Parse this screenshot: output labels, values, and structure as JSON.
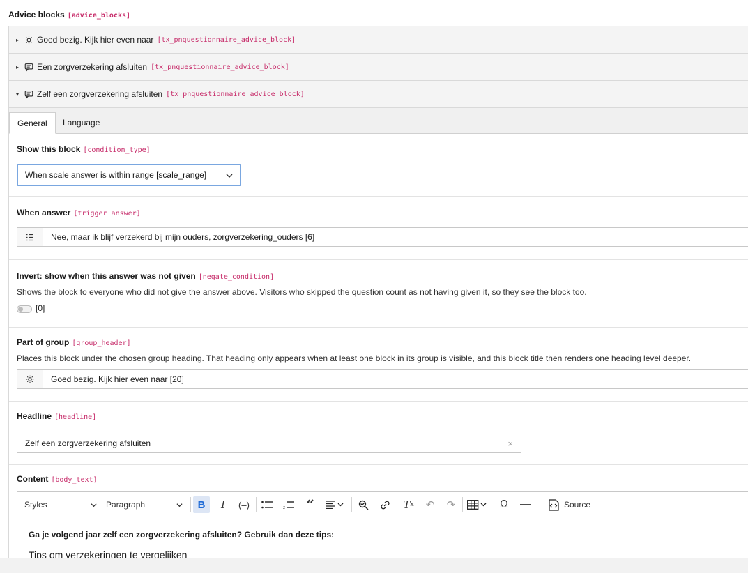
{
  "section": {
    "title": "Advice blocks",
    "key": "[advice_blocks]"
  },
  "panels": [
    {
      "title": "Goed bezig. Kijk hier even naar",
      "key": "[tx_pnquestionnaire_advice_block]",
      "icon": "lightbulb-icon",
      "expanded": false
    },
    {
      "title": "Een zorgverzekering afsluiten",
      "key": "[tx_pnquestionnaire_advice_block]",
      "icon": "message-icon",
      "expanded": false
    },
    {
      "title": "Zelf een zorgverzekering afsluiten",
      "key": "[tx_pnquestionnaire_advice_block]",
      "icon": "message-icon",
      "expanded": true
    }
  ],
  "tabs": [
    {
      "label": "General",
      "active": true
    },
    {
      "label": "Language",
      "active": false
    }
  ],
  "fields": {
    "condition": {
      "label": "Show this block",
      "key": "[condition_type]",
      "value": "When scale answer is within range [scale_range]"
    },
    "trigger": {
      "label": "When answer",
      "key": "[trigger_answer]",
      "value": "Nee, maar ik blijf verzekerd bij mijn ouders, zorgverzekering_ouders [6]"
    },
    "negate": {
      "label": "Invert: show when this answer was not given",
      "key": "[negate_condition]",
      "description": "Shows the block to everyone who did not give the answer above. Visitors who skipped the question count as not having given it, so they see the block too.",
      "value": "[0]"
    },
    "group": {
      "label": "Part of group",
      "key": "[group_header]",
      "description": "Places this block under the chosen group heading. That heading only appears when at least one block in its group is visible, and this block title then renders one heading level deeper.",
      "value": "Goed bezig. Kijk hier even naar [20]"
    },
    "headline": {
      "label": "Headline",
      "key": "[headline]",
      "value": "Zelf een zorgverzekering afsluiten"
    },
    "content": {
      "label": "Content",
      "key": "[body_text]"
    }
  },
  "editor": {
    "styles_label": "Styles",
    "format_label": "Paragraph",
    "source_label": "Source",
    "para1": "Ga je volgend jaar zelf een zorgverzekering afsluiten? Gebruik dan deze tips:",
    "heading1": "Tips om verzekeringen te vergelijken"
  },
  "colors": {
    "key": "#c72c6a",
    "focus": "#7aa7e0",
    "active_btn": "#1f6bd6"
  }
}
